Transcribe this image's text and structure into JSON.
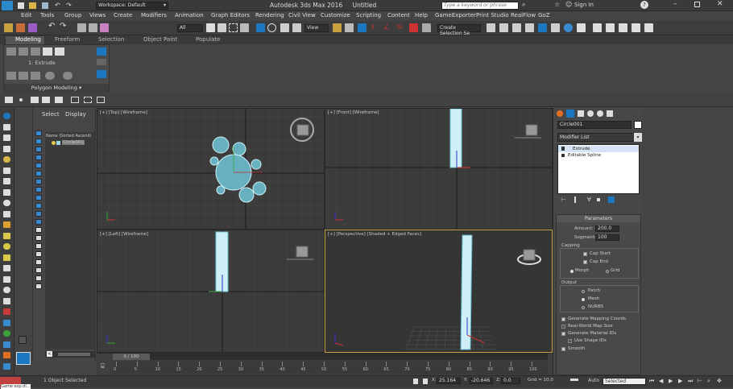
{
  "app": {
    "title": "Autodesk 3ds Max 2016",
    "document": "Untitled",
    "workspace": "Workspace: Default",
    "search_placeholder": "Type a keyword or phrase",
    "sign_in": "Sign In"
  },
  "menu": [
    "Edit",
    "Tools",
    "Group",
    "Views",
    "Create",
    "Modifiers",
    "Animation",
    "Graph Editors",
    "Rendering",
    "Civil View",
    "Customize",
    "Scripting",
    "Content",
    "Help",
    "GameExporter",
    "Print Studio",
    "RealFlow",
    "GoZ"
  ],
  "toolbar": {
    "selection_filter": "All",
    "ref_coord": "View",
    "named_selection": "Create Selection Se"
  },
  "ribbon": {
    "tabs": [
      "Modeling",
      "Freeform",
      "Selection",
      "Object Paint",
      "Populate"
    ],
    "active_tab": "Modeling",
    "current_op": "1: Extrude",
    "panel_name": "Polygon Modeling"
  },
  "scene_explorer": {
    "tabs": [
      "Select",
      "Display"
    ],
    "column_header": "Name (Sorted Ascendi",
    "items": [
      "Circle001"
    ]
  },
  "viewports": {
    "top": "[+] [Top] [Wireframe]",
    "front": "[+] [Front] [Wireframe]",
    "left": "[+] [Left] [Wireframe]",
    "perspective": "[+] [Perspective] [Shaded + Edged Faces]"
  },
  "command_panel": {
    "object_name": "Circle001",
    "modifier_list": "Modifier List",
    "stack": [
      "Extrude",
      "Editable Spline"
    ],
    "rollout_title": "Parameters",
    "amount_label": "Amount:",
    "amount_value": "200.0",
    "segments_label": "Segments:",
    "segments_value": "100",
    "capping_label": "Capping",
    "cap_start": "Cap Start",
    "cap_end": "Cap End",
    "morph": "Morph",
    "grid": "Grid",
    "output_label": "Output",
    "patch": "Patch",
    "mesh": "Mesh",
    "nurbs": "NURBS",
    "gen_mapping": "Generate Mapping Coords.",
    "real_world": "Real-World Map Size",
    "gen_material": "Generate Material IDs",
    "use_shape": "Use Shape IDs",
    "smooth": "Smooth"
  },
  "timeline": {
    "frame_counter": "0 / 100",
    "ticks": [
      "0",
      "5",
      "10",
      "15",
      "20",
      "25",
      "30",
      "35",
      "40",
      "45",
      "50",
      "55",
      "60",
      "65",
      "70",
      "75",
      "80",
      "85",
      "90",
      "95",
      "100"
    ]
  },
  "status": {
    "selection": "1 Object Selected",
    "maxscript": "Game exp.dl...",
    "x_label": "X:",
    "x_value": "25.164",
    "y_label": "Y:",
    "y_value": "-20.646",
    "z_label": "Z:",
    "z_value": "0.0",
    "grid_value": "Grid = 10.0",
    "auto_key": "Auto",
    "selected_dropdown": "Selected"
  },
  "colors": {
    "accent_blue": "#1a78c2",
    "object_cyan": "#7fd6e6",
    "viewport_bg": "#3b3b3b",
    "perspective_bg": "#353535"
  }
}
